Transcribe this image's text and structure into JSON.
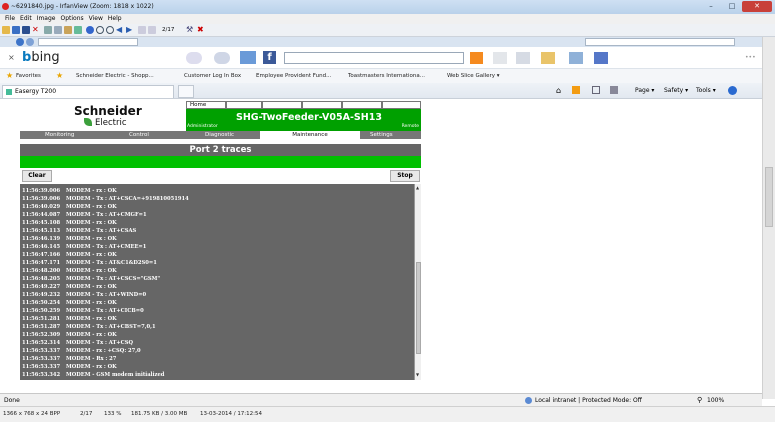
{
  "window": {
    "title": "~6291840.jpg - IrfanView (Zoom: 1818 x 1022)",
    "menu": [
      "File",
      "Edit",
      "Image",
      "Options",
      "View",
      "Help"
    ],
    "page_counter": "2/17"
  },
  "browser": {
    "search_brand": "bing",
    "favorites": {
      "label": "Favorites",
      "items": [
        "Schneider Electric - Shopp...",
        "Customer Log In Box",
        "Employee Provident Fund...",
        "Toastmasters Internationa...",
        "Web Slice Gallery ▾"
      ]
    },
    "tab_title": "Easergy T200",
    "commands": [
      "Page ▾",
      "Safety ▾",
      "Tools ▾"
    ],
    "status_left": "Done",
    "zone": "Local intranet | Protected Mode: Off",
    "zoom": "100%"
  },
  "app": {
    "logo_line1": "Schneider",
    "logo_line2": "Electric",
    "home_label": "Home",
    "device_title": "SHG-TwoFeeder-V05A-SH13",
    "admin_label": "Administrator",
    "remote_label": "Remote",
    "nav": [
      "Monitoring",
      "Control",
      "Diagnostic",
      "Maintenance",
      "Settings"
    ],
    "section_title": "Port 2 traces",
    "clear_label": "Clear",
    "stop_label": "Stop",
    "log": [
      {
        "t": "11:56:39.006",
        "m": "MODEM - rx : OK"
      },
      {
        "t": "11:56:39.006",
        "m": "MODEM - Tx : AT+CSCA=+919810051914"
      },
      {
        "t": "11:56:40.029",
        "m": "MODEM - rx : OK"
      },
      {
        "t": "11:56:44.087",
        "m": "MODEM - Tx : AT+CMGF=1"
      },
      {
        "t": "11:56:45.108",
        "m": "MODEM - rx : OK"
      },
      {
        "t": "11:56:45.113",
        "m": "MODEM - Tx : AT+CSAS"
      },
      {
        "t": "11:56:46.139",
        "m": "MODEM - rx : OK"
      },
      {
        "t": "11:56:46.145",
        "m": "MODEM - Tx : AT+CMEE=1"
      },
      {
        "t": "11:56:47.166",
        "m": "MODEM - rx : OK"
      },
      {
        "t": "11:56:47.171",
        "m": "MODEM - Tx : AT&C1&D2S0=1"
      },
      {
        "t": "11:56:48.200",
        "m": "MODEM - rx : OK"
      },
      {
        "t": "11:56:48.205",
        "m": "MODEM - Tx : AT+CSCS=\"GSM\""
      },
      {
        "t": "11:56:49.227",
        "m": "MODEM - rx : OK"
      },
      {
        "t": "11:56:49.232",
        "m": "MODEM - Tx : AT+WIND=0"
      },
      {
        "t": "11:56:50.254",
        "m": "MODEM - rx : OK"
      },
      {
        "t": "11:56:50.259",
        "m": "MODEM - Tx : AT+CICB=0"
      },
      {
        "t": "11:56:51.281",
        "m": "MODEM - rx : OK"
      },
      {
        "t": "11:56:51.287",
        "m": "MODEM - Tx : AT+CBST=7,0,1"
      },
      {
        "t": "11:56:52.309",
        "m": "MODEM - rx : OK"
      },
      {
        "t": "11:56:52.314",
        "m": "MODEM - Tx : AT+CSQ"
      },
      {
        "t": "11:56:53.337",
        "m": "MODEM - rx : +CSQ: 27,0"
      },
      {
        "t": "11:56:53.337",
        "m": "MODEM - Rx : 27"
      },
      {
        "t": "11:56:53.337",
        "m": "MODEM - rx : OK"
      },
      {
        "t": "11:56:53.342",
        "m": "MODEM - GSM modem initialized"
      }
    ]
  },
  "image_status": {
    "dims": "1366 x 768 x 24 BPP",
    "page": "2/17",
    "zoom": "133 %",
    "size": "181.75 KB / 3.00 MB",
    "date": "13-03-2014 / 17:12:54"
  },
  "colors": {
    "green_header": "#00a000",
    "green_bar": "#00c000",
    "log_bg": "#666666"
  }
}
